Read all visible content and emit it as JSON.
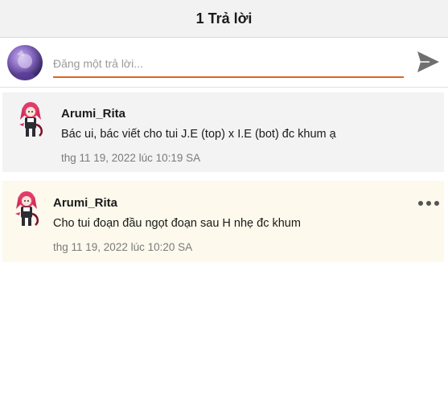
{
  "header": {
    "title": "1 Trả lời"
  },
  "compose": {
    "placeholder": "Đăng một trả lời...",
    "send_icon": "send-icon",
    "accent_color": "#e0641e"
  },
  "replies": [
    {
      "author": "Arumi_Rita",
      "text": "Bác ui, bác viết cho tui J.E (top) x I.E (bot) đc khum ạ",
      "time": "thg 11 19, 2022 lúc 10:19 SA"
    },
    {
      "author": "Arumi_Rita",
      "text": "Cho tui đoạn đầu ngọt đoạn sau H nhẹ đc khum",
      "time": "thg 11 19, 2022 lúc 10:20 SA",
      "more_icon": "more-horizontal-icon"
    }
  ]
}
